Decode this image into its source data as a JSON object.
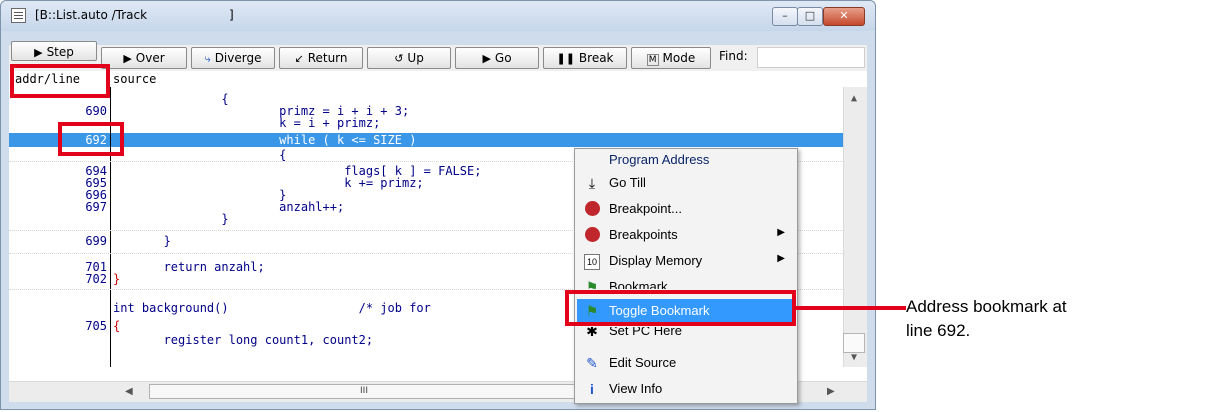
{
  "window": {
    "title": "[B::List.auto /Track",
    "title_bracket": "]",
    "controls": {
      "minimize": "–",
      "maximize": "□",
      "close": "✕"
    }
  },
  "toolbar": {
    "buttons": [
      {
        "label": "Step",
        "icon": "step-icon"
      },
      {
        "label": "Over",
        "icon": "step-over-icon"
      },
      {
        "label": "Diverge",
        "icon": "diverge-icon"
      },
      {
        "label": "Return",
        "icon": "return-icon"
      },
      {
        "label": "Up",
        "icon": "up-icon"
      },
      {
        "label": "Go",
        "icon": "go-icon"
      },
      {
        "label": "Break",
        "icon": "break-icon"
      },
      {
        "label": "Mode",
        "icon": "mode-icon"
      }
    ],
    "find_label": "Find:"
  },
  "columns": {
    "addr": "addr/line",
    "source": "source"
  },
  "code_lines": [
    {
      "line": "",
      "src": "               {"
    },
    {
      "line": "690",
      "src": "                       primz = i + i + 3;"
    },
    {
      "line": "",
      "src": "                       k = i + primz;"
    },
    {
      "line": "692",
      "src": "                       while ( k <= SIZE )"
    },
    {
      "line": "",
      "src": "                       {"
    },
    {
      "line": "694",
      "src": "                                flags[ k ] = FALSE;"
    },
    {
      "line": "695",
      "src": "                                k += primz;"
    },
    {
      "line": "696",
      "src": "                       }"
    },
    {
      "line": "697",
      "src": "                       anzahl++;"
    },
    {
      "line": "",
      "src": "               }"
    },
    {
      "line": "699",
      "src": "       }"
    },
    {
      "line": "701",
      "src": "       return anzahl;"
    },
    {
      "line": "702",
      "src": "}"
    },
    {
      "line": "",
      "src": "int background()                  /* job for"
    },
    {
      "line": "705",
      "src": "{"
    },
    {
      "line": "",
      "src": "       register long count1, count2;"
    }
  ],
  "context_menu": {
    "header": "Program Address",
    "items": [
      {
        "label": "Go Till",
        "icon": "go-till-icon",
        "submenu": false
      },
      {
        "label": "Breakpoint...",
        "icon": "breakpoint-icon",
        "submenu": false
      },
      {
        "label": "Breakpoints",
        "icon": "breakpoints-icon",
        "submenu": true
      },
      {
        "label": "Display Memory",
        "icon": "display-memory-icon",
        "submenu": true
      },
      {
        "label": "Bookmark",
        "icon": "bookmark-icon",
        "submenu": false
      },
      {
        "label": "Toggle Bookmark",
        "icon": "toggle-bookmark-icon",
        "submenu": false,
        "highlighted": true
      },
      {
        "label": "Set PC Here",
        "icon": "set-pc-icon",
        "submenu": false
      },
      {
        "label": "Edit Source",
        "icon": "edit-source-icon",
        "submenu": false
      },
      {
        "label": "View Info",
        "icon": "view-info-icon",
        "submenu": false
      }
    ]
  },
  "callout": {
    "line1": "Address bookmark at",
    "line2": "line 692."
  },
  "colors": {
    "highlight": "#3399ff",
    "annotation": "#e3001b",
    "code": "#000088"
  }
}
